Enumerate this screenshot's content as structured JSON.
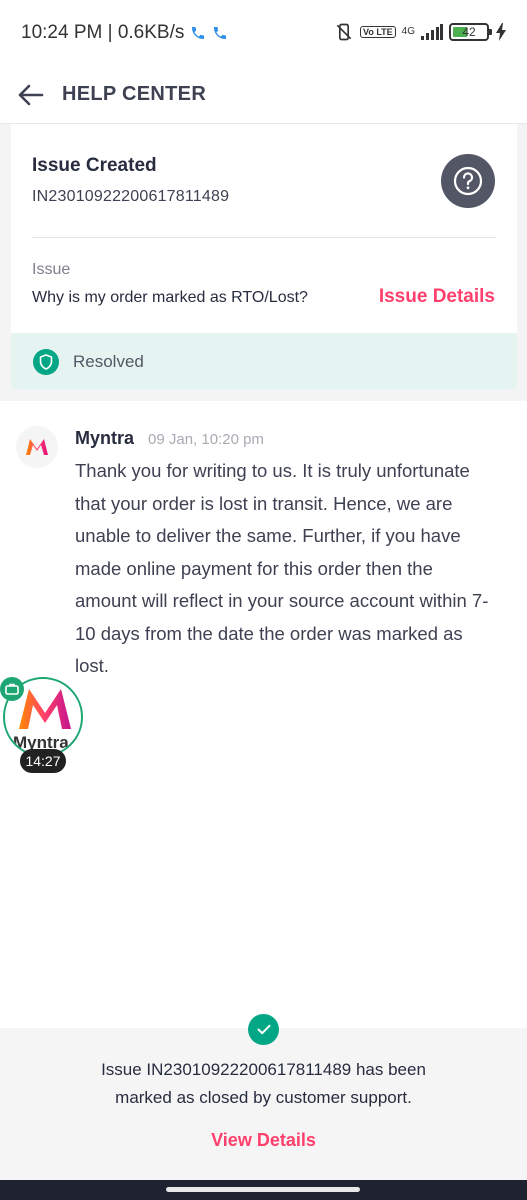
{
  "status_bar": {
    "time_speed": "10:24 PM | 0.6KB/s",
    "network": "4G",
    "volte": "Vo LTE",
    "battery": "42"
  },
  "header": {
    "title": "HELP CENTER"
  },
  "issue_card": {
    "heading": "Issue Created",
    "issue_id": "IN23010922200617811489",
    "issue_label": "Issue",
    "question": "Why is my order marked as RTO/Lost?",
    "details_link": "Issue Details",
    "status": "Resolved"
  },
  "message": {
    "sender": "Myntra",
    "timestamp": "09 Jan, 10:20 pm",
    "body": "Thank you for writing to us. It is truly unfortunate that your order is lost in transit. Hence, we are unable to deliver the same. Further, if you have made online payment for this order then the amount will reflect in your source account within 7-10 days from the date the order was marked as lost."
  },
  "floating_bubble": {
    "label": "Myntra",
    "timer": "14:27"
  },
  "bottom_panel": {
    "line1": "Issue IN23010922200617811489 has been",
    "line2": "marked as closed by customer support.",
    "link": "View Details"
  },
  "colors": {
    "accent": "#ff3f6c",
    "success": "#03a685",
    "text_primary": "#282c3f"
  }
}
